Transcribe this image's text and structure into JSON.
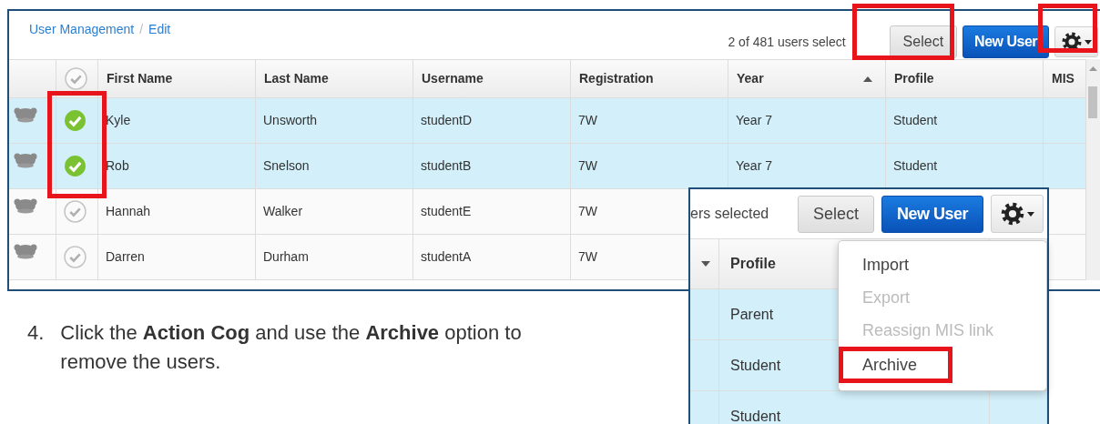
{
  "main": {
    "breadcrumb": [
      "User Management",
      "Edit"
    ],
    "breadcrumb_separator": "/",
    "selection_count": "2 of 481 users select",
    "select_button": {
      "label": "Select",
      "highlighted": true
    },
    "new_user_button": {
      "label": "New User"
    },
    "cog_button": {
      "highlighted": true
    },
    "table": {
      "select_all": false,
      "selection_highlighted": true,
      "columns": [
        {
          "label": "First Name"
        },
        {
          "label": "Last Name"
        },
        {
          "label": "Username"
        },
        {
          "label": "Registration"
        },
        {
          "label": "Year",
          "sorted": true,
          "ascending": true
        },
        {
          "label": "Profile"
        },
        {
          "label": "MIS"
        }
      ],
      "rows": [
        {
          "selected": true,
          "cells": [
            "Kyle",
            "Unsworth",
            "studentD",
            "7W",
            "Year 7",
            "Student"
          ]
        },
        {
          "selected": true,
          "cells": [
            "Rob",
            "Snelson",
            "studentB",
            "7W",
            "Year 7",
            "Student"
          ]
        },
        {
          "selected": false,
          "cells": [
            "Hannah",
            "Walker",
            "studentE",
            "7W"
          ]
        },
        {
          "selected": false,
          "cells": [
            "Darren",
            "Durham",
            "studentA",
            "7W"
          ]
        }
      ]
    }
  },
  "inset": {
    "selection_count": "ers selected",
    "select_button": {
      "label": "Select"
    },
    "new_user_button": {
      "label": "New User"
    },
    "columns": [
      {
        "sorted": true,
        "ascending": false
      },
      {
        "label": "Profile"
      }
    ],
    "rows": [
      {
        "selected": true,
        "profile": "Parent"
      },
      {
        "selected": true,
        "profile": "Student"
      },
      {
        "selected": true,
        "profile": "Student"
      }
    ],
    "menu": {
      "items": [
        {
          "label": "Import",
          "disabled": false,
          "highlighted": false
        },
        {
          "label": "Export",
          "disabled": true,
          "highlighted": false
        },
        {
          "label": "Reassign MIS link",
          "disabled": true,
          "highlighted": false
        },
        {
          "label": "Archive",
          "disabled": false,
          "highlighted": true
        }
      ]
    }
  },
  "instruction": {
    "number": "4.",
    "text": "Click the **Action Cog** and use the **Archive** option to remove the users."
  }
}
